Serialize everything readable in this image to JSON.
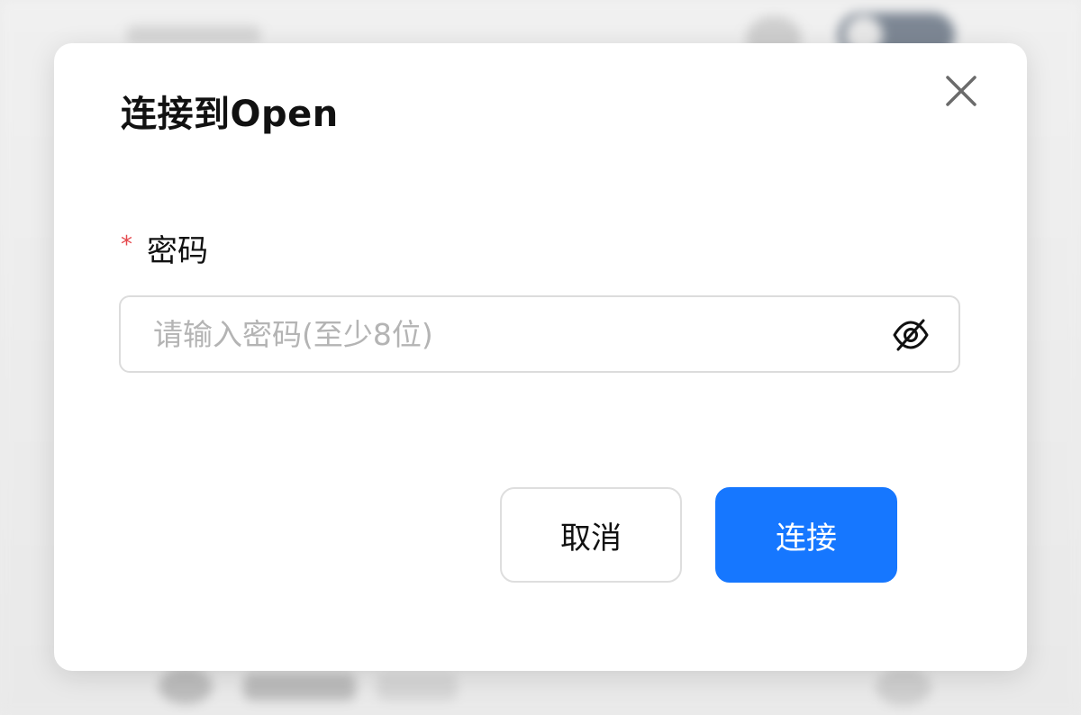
{
  "dialog": {
    "title": "连接到Open",
    "close_icon": "close-icon",
    "password_field": {
      "required_mark": "*",
      "label": "密码",
      "value": "",
      "placeholder": "请输入密码(至少8位)",
      "visibility_icon": "eye-off-icon"
    },
    "buttons": {
      "cancel_label": "取消",
      "connect_label": "连接"
    }
  },
  "colors": {
    "primary": "#1677ff",
    "required": "#e5484d",
    "placeholder": "#b4b4b4",
    "border": "#dcdcdc"
  }
}
